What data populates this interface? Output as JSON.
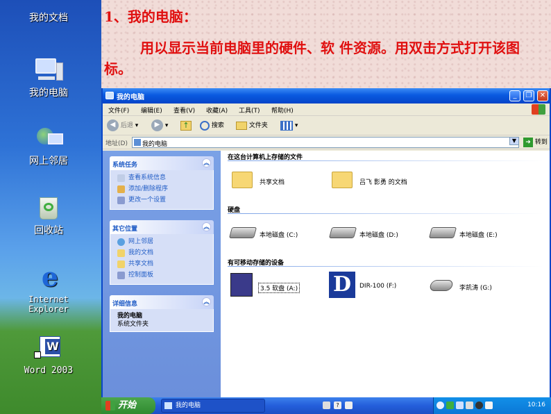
{
  "desktop": {
    "icons": [
      {
        "label": "我的文档",
        "icon": "my-documents-icon"
      },
      {
        "label": "我的电脑",
        "icon": "my-computer-icon"
      },
      {
        "label": "网上邻居",
        "icon": "network-places-icon"
      },
      {
        "label": "回收站",
        "icon": "recycle-bin-icon"
      },
      {
        "label": "Internet Explorer",
        "icon": "internet-explorer-icon"
      },
      {
        "label": "Word 2003",
        "icon": "word-icon"
      }
    ]
  },
  "slide": {
    "title": "1、我的电脑：",
    "body": "用以显示当前电脑里的硬件、软 件资源。用双击方式打开该图标。"
  },
  "window": {
    "title": "我的电脑",
    "menu": [
      "文件(F)",
      "编辑(E)",
      "查看(V)",
      "收藏(A)",
      "工具(T)",
      "帮助(H)"
    ],
    "toolbar": {
      "back": "后退",
      "search": "搜索",
      "folders": "文件夹"
    },
    "address": {
      "label": "地址(D)",
      "value": "我的电脑",
      "go": "转到"
    }
  },
  "taskpane": {
    "system_tasks": {
      "title": "系统任务",
      "links": [
        "查看系统信息",
        "添加/删除程序",
        "更改一个设置"
      ]
    },
    "other_places": {
      "title": "其它位置",
      "links": [
        "网上邻居",
        "我的文档",
        "共享文档",
        "控制面板"
      ]
    },
    "details": {
      "title": "详细信息",
      "name": "我的电脑",
      "type": "系统文件夹"
    }
  },
  "content": {
    "files_header": "在这台计算机上存储的文件",
    "files": [
      "共享文档",
      "吕飞    影勇 的文档"
    ],
    "disks_header": "硬盘",
    "disks": [
      "本地磁盘 (C:)",
      "本地磁盘 (D:)",
      "本地磁盘 (E:)"
    ],
    "removable_header": "有可移动存储的设备",
    "removable": [
      "3.5 软盘 (A:)",
      "DIR-100 (F:)",
      "李凯涛 (G:)"
    ]
  },
  "taskbar": {
    "start": "开始",
    "task": "我的电脑",
    "clock": "10:16"
  }
}
